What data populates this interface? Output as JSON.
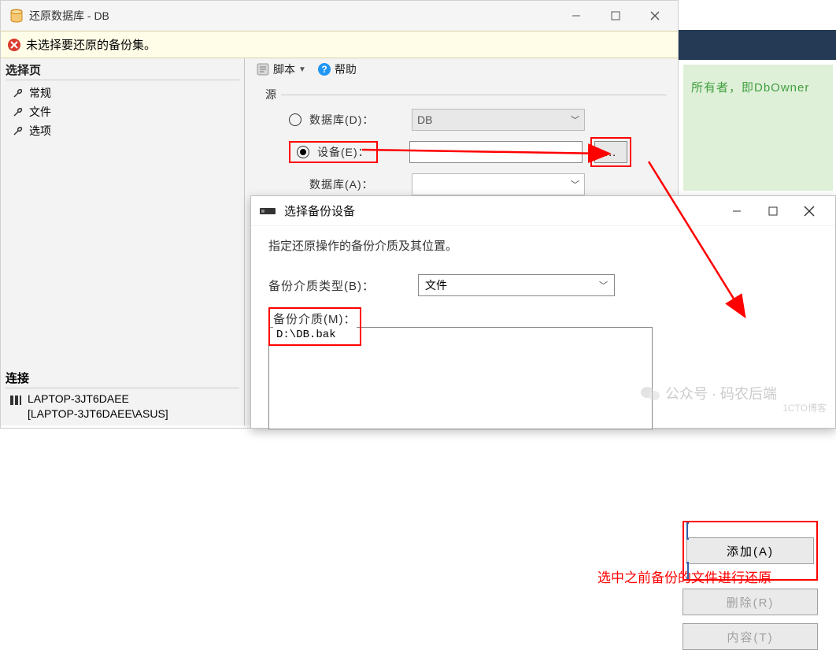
{
  "window": {
    "title": "还原数据库 - DB",
    "error": "未选择要还原的备份集。"
  },
  "sidebar": {
    "heading": "选择页",
    "items": [
      {
        "label": "常规"
      },
      {
        "label": "文件"
      },
      {
        "label": "选项"
      }
    ],
    "conn_heading": "连接",
    "conn_main": "LAPTOP-3JT6DAEE",
    "conn_sub": "[LAPTOP-3JT6DAEE\\ASUS]"
  },
  "toolbar": {
    "script_label": "脚本",
    "help_label": "帮助"
  },
  "source": {
    "group_title": "源",
    "database_label": "数据库(D)：",
    "device_label": "设备(E)：",
    "database_key_a_label": "数据库(A)：",
    "database_value": "DB",
    "browse_label": "..."
  },
  "dialog2": {
    "title": "选择备份设备",
    "instruction": "指定还原操作的备份介质及其位置。",
    "media_type_label": "备份介质类型(B)：",
    "media_type_value": "文件",
    "media_label": "备份介质(M)：",
    "media_item": "D:\\DB.bak",
    "annotation": "选中之前备份的文件进行还原",
    "add_label": "添加(A)",
    "delete_label": "删除(R)",
    "content_label": "内容(T)"
  },
  "bg_note": "所有者，即DbOwner",
  "watermark": {
    "main": "公众号 · 码农后端",
    "sec": "1CTO博客"
  }
}
